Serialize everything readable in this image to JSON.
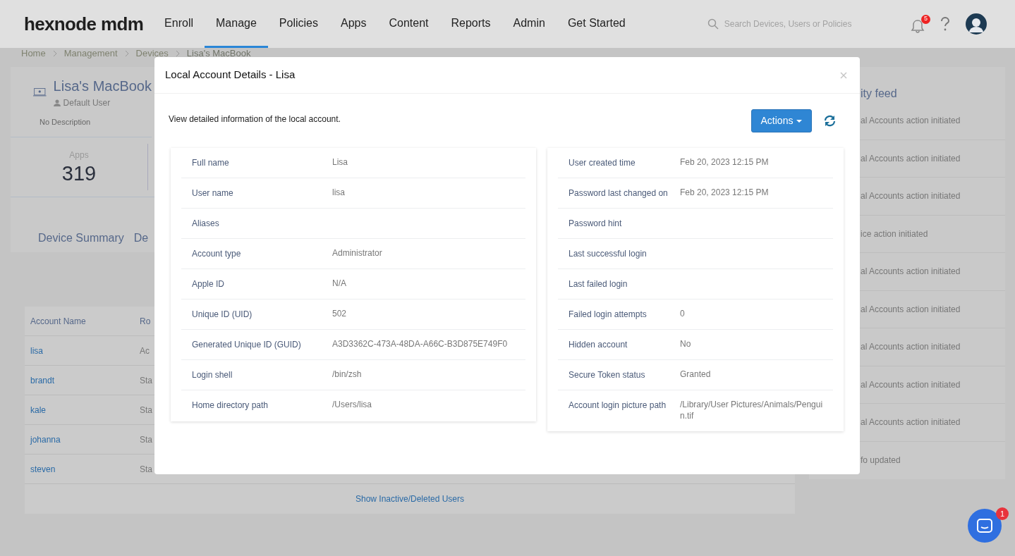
{
  "header": {
    "logo": "hexnode mdm",
    "nav": [
      {
        "label": "Enroll",
        "selected": false
      },
      {
        "label": "Manage",
        "selected": true
      },
      {
        "label": "Policies",
        "selected": false
      },
      {
        "label": "Apps",
        "selected": false
      },
      {
        "label": "Content",
        "selected": false
      },
      {
        "label": "Reports",
        "selected": false
      },
      {
        "label": "Admin",
        "selected": false
      },
      {
        "label": "Get Started",
        "selected": false
      }
    ],
    "search": {
      "placeholder": "Search Devices, Users or Policies"
    },
    "notification_count": "5"
  },
  "breadcrumb": [
    "Home",
    "Management",
    "Devices",
    "Lisa's MacBook"
  ],
  "device": {
    "name": "Lisa's MacBook",
    "user": "Default User",
    "description": "No Description"
  },
  "stats": [
    {
      "label": "Apps",
      "value": "319"
    }
  ],
  "tabs": [
    "Device Summary",
    "De"
  ],
  "accounts_table": {
    "columns": [
      "Account Name",
      "Ro"
    ],
    "rows": [
      [
        "lisa",
        "Ac"
      ],
      [
        "brandt",
        "Sta"
      ],
      [
        "kale",
        "Sta"
      ],
      [
        "johanna",
        "Sta"
      ],
      [
        "steven",
        "Sta"
      ]
    ],
    "footer_link": "Show Inactive/Deleted Users"
  },
  "activity_feed": {
    "title": "ity feed",
    "items": [
      "al Accounts action initiated",
      "al Accounts action initiated",
      "al Accounts action initiated",
      "ice action initiated",
      "al Accounts action initiated",
      "al Accounts action initiated",
      "al Accounts action initiated",
      "al Accounts action initiated",
      "al Accounts action initiated",
      "fo updated"
    ]
  },
  "modal": {
    "title": "Local Account Details - Lisa",
    "description": "View detailed information of the local account.",
    "actions_button": "Actions",
    "left_fields": [
      {
        "label": "Full name",
        "value": "Lisa"
      },
      {
        "label": "User name",
        "value": "lisa"
      },
      {
        "label": "Aliases"
      },
      {
        "label": "Account type",
        "value": "Administrator"
      },
      {
        "label": "Apple ID",
        "value": "N/A"
      },
      {
        "label": "Unique ID (UID)",
        "value": "502"
      },
      {
        "label": "Generated Unique ID (GUID)",
        "value": "A3D3362C-473A-48DA-A66C-B3D875E749F0"
      },
      {
        "label": "Login shell",
        "value": "/bin/zsh"
      },
      {
        "label": "Home directory path",
        "value": "/Users/lisa"
      }
    ],
    "right_fields": [
      {
        "label": "User created time",
        "value": "Feb 20, 2023 12:15 PM"
      },
      {
        "label": "Password last changed on",
        "value": "Feb 20, 2023 12:15 PM"
      },
      {
        "label": "Password hint"
      },
      {
        "label": "Last successful login"
      },
      {
        "label": "Last failed login"
      },
      {
        "label": "Failed login attempts",
        "value": "0"
      },
      {
        "label": "Hidden account",
        "value": "No"
      },
      {
        "label": "Secure Token status",
        "value": "Granted"
      },
      {
        "label": "Account login picture path",
        "value": "/Library/User Pictures/Animals/Penguin.tif"
      }
    ]
  },
  "chat": {
    "badge": "1"
  }
}
